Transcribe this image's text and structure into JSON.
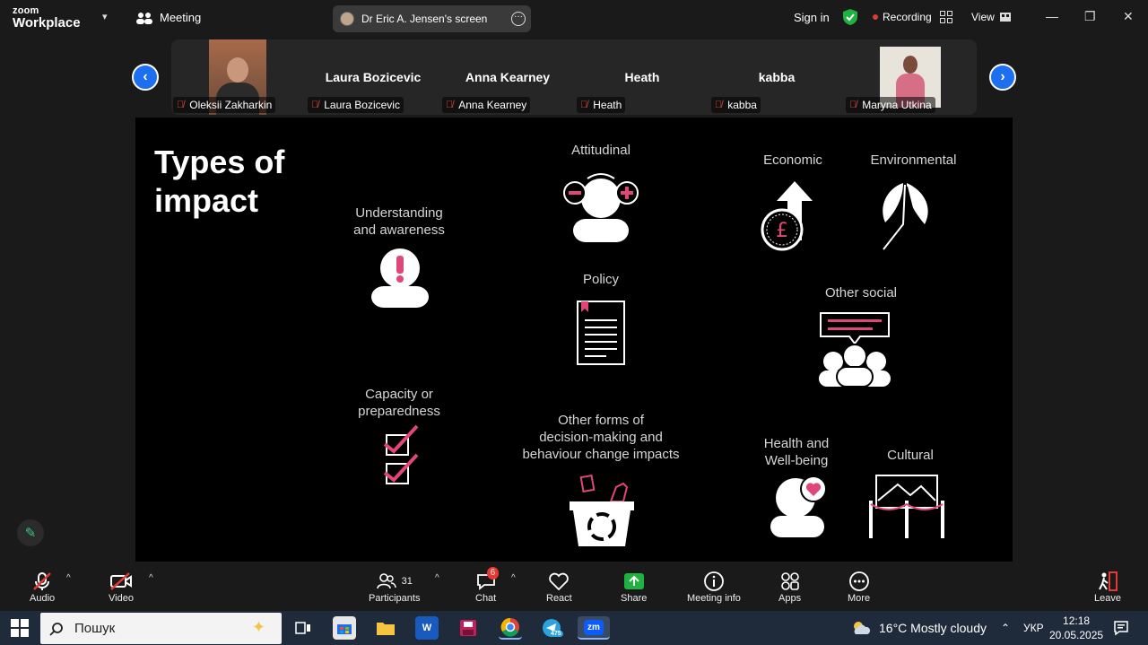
{
  "titlebar": {
    "brand_top": "zoom",
    "brand_bottom": "Workplace",
    "meeting_label": "Meeting",
    "screen_share_label": "Dr Eric A. Jensen's screen",
    "signin": "Sign in",
    "recording": "Recording",
    "view": "View"
  },
  "participants_strip": [
    {
      "name": "",
      "label": "Oleksii Zakharkin"
    },
    {
      "name": "Laura Bozicevic",
      "label": "Laura Bozicevic"
    },
    {
      "name": "Anna Kearney",
      "label": "Anna Kearney"
    },
    {
      "name": "Heath",
      "label": "Heath"
    },
    {
      "name": "kabba",
      "label": "kabba"
    },
    {
      "name": "",
      "label": "Maryna Utkina"
    }
  ],
  "slide": {
    "title_line1": "Types of",
    "title_line2": "impact",
    "labels": {
      "attitudinal": "Attitudinal",
      "economic": "Economic",
      "environmental": "Environmental",
      "understanding_1": "Understanding",
      "understanding_2": "and awareness",
      "policy": "Policy",
      "other_social": "Other social",
      "capacity_1": "Capacity or",
      "capacity_2": "preparedness",
      "other_forms_1": "Other forms of",
      "other_forms_2": "decision-making and",
      "other_forms_3": "behaviour change impacts",
      "health_1": "Health and",
      "health_2": "Well-being",
      "cultural": "Cultural"
    },
    "accent_color": "#e0457b"
  },
  "toolbar": {
    "audio": "Audio",
    "video": "Video",
    "participants": "Participants",
    "participants_count": "31",
    "chat": "Chat",
    "chat_badge": "6",
    "react": "React",
    "share": "Share",
    "meeting_info": "Meeting info",
    "apps": "Apps",
    "more": "More",
    "leave": "Leave"
  },
  "taskbar": {
    "search_placeholder": "Пошук",
    "telegram_badge": "475",
    "weather": "16°C  Mostly cloudy",
    "lang": "УКР",
    "time": "12:18",
    "date": "20.05.2025"
  }
}
